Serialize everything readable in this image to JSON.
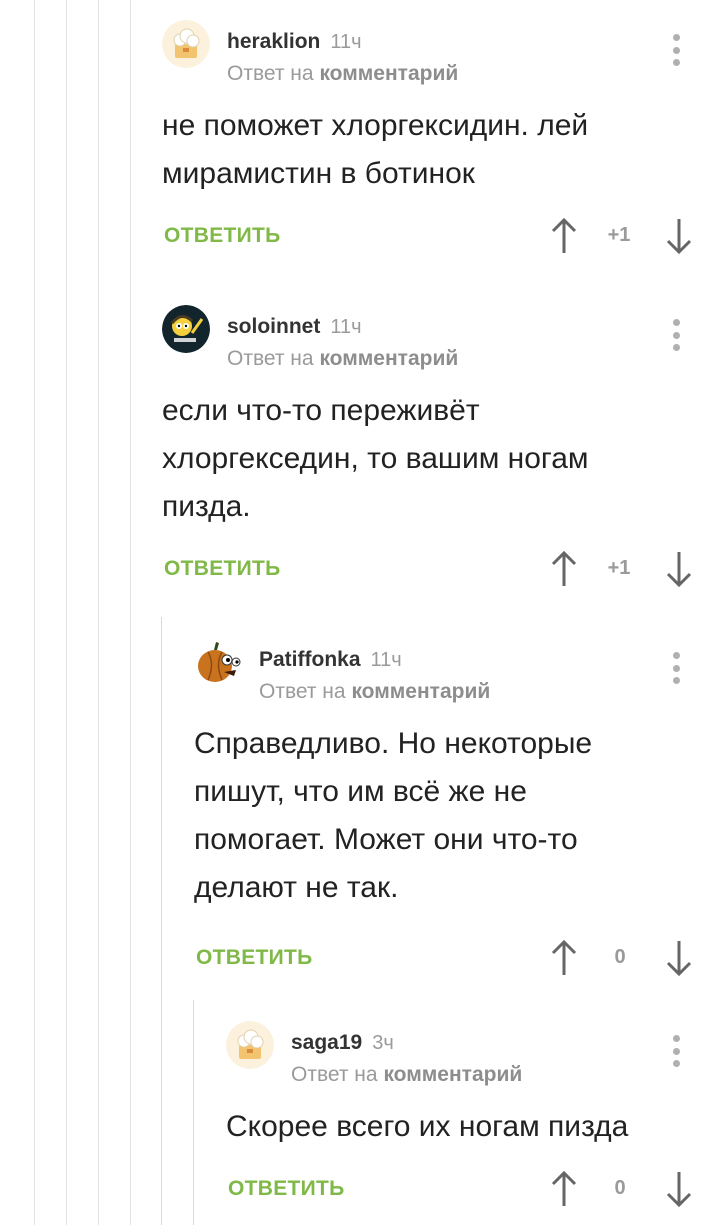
{
  "comments": [
    {
      "author": "heraklion",
      "time": "11ч",
      "reply_prefix": "Ответ на",
      "reply_link": "комментарий",
      "text": "не поможет хлоргексидин. лей мирамистин в ботинок",
      "reply_label": "ОТВЕТИТЬ",
      "score": "+1",
      "avatar_icon": "chef-hat-avatar-icon"
    },
    {
      "author": "soloinnet",
      "time": "11ч",
      "reply_prefix": "Ответ на",
      "reply_link": "комментарий",
      "text": "если что-то переживёт хлоргекседин, то вашим ногам пизда.",
      "reply_label": "ОТВЕТИТЬ",
      "score": "+1",
      "avatar_icon": "cartoon-character-avatar-icon"
    },
    {
      "author": "Patiffonka",
      "time": "11ч",
      "reply_prefix": "Ответ на",
      "reply_link": "комментарий",
      "text": "Справедливо. Но некоторые пишут, что им всё же не помогает. Может они что-то делают не так.",
      "reply_label": "ОТВЕТИТЬ",
      "score": "0",
      "avatar_icon": "pumpkin-avatar-icon"
    },
    {
      "author": "saga19",
      "time": "3ч",
      "reply_prefix": "Ответ на",
      "reply_link": "комментарий",
      "text": "Скорее всего их ногам пизда",
      "reply_label": "ОТВЕТИТЬ",
      "score": "0",
      "avatar_icon": "chef-hat-avatar-icon"
    }
  ],
  "colors": {
    "accent_green": "#80b947",
    "muted_gray": "#9a9a9a",
    "thread_line": "#e3e3e3"
  }
}
